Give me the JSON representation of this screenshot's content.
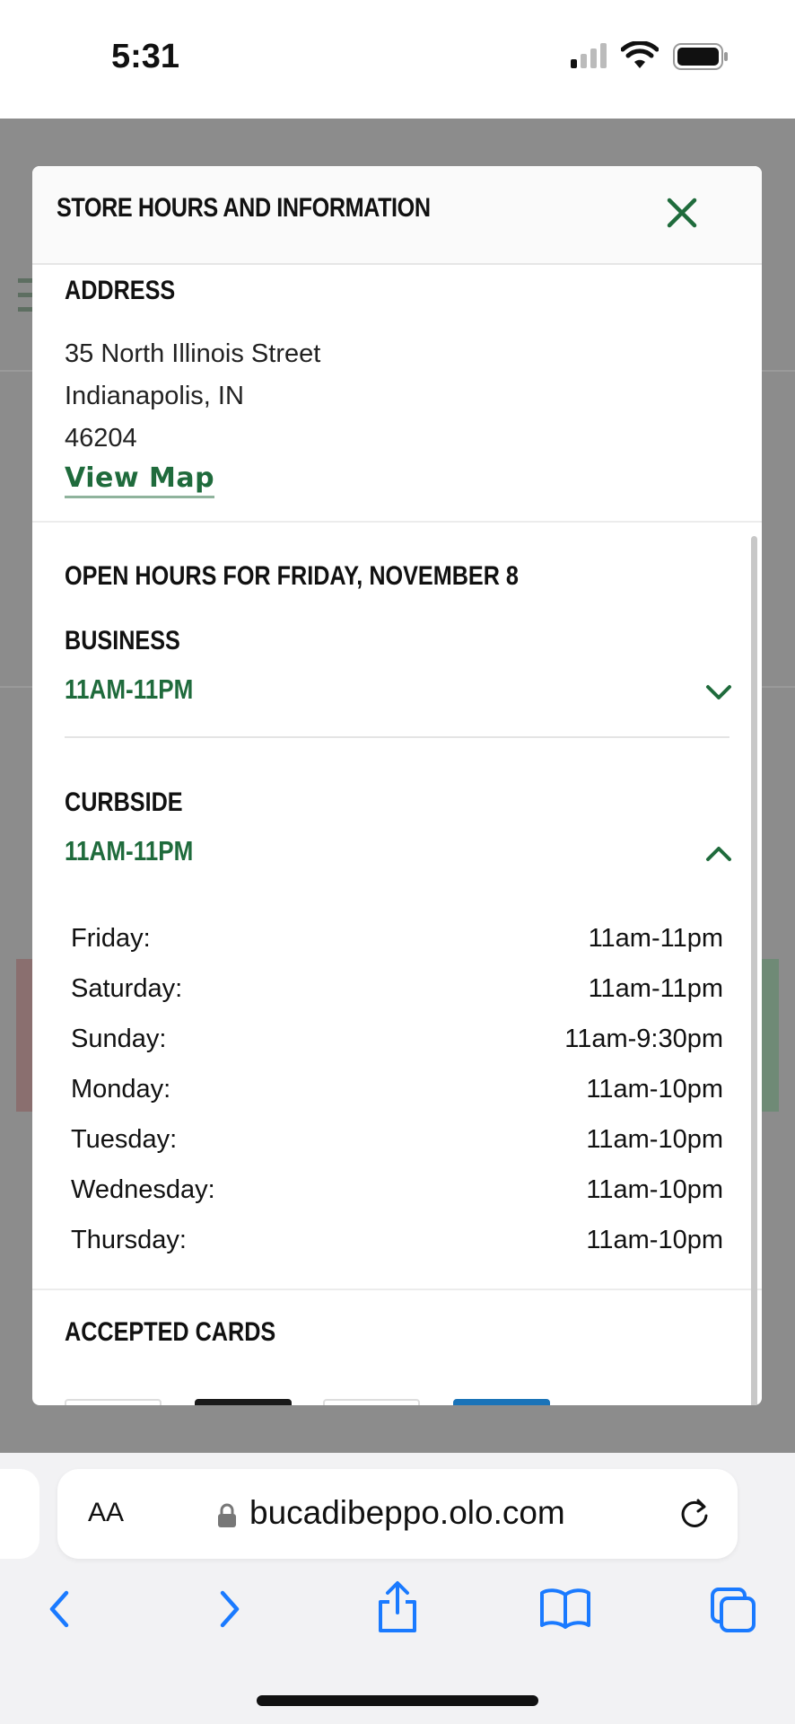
{
  "status_bar": {
    "time": "5:31"
  },
  "modal": {
    "title": "Store Hours and Information",
    "address": {
      "heading": "Address",
      "street": "35 North Illinois Street",
      "city_state": "Indianapolis, IN",
      "zip": "46204",
      "view_map": "View Map"
    },
    "open_hours_heading": "Open hours for Friday, November 8",
    "business": {
      "label": "Business",
      "hours": "11AM-11PM",
      "expanded": false
    },
    "curbside": {
      "label": "Curbside",
      "hours": "11AM-11PM",
      "expanded": true,
      "schedule": [
        {
          "day": "Friday:",
          "hours": "11am-11pm"
        },
        {
          "day": "Saturday:",
          "hours": "11am-11pm"
        },
        {
          "day": "Sunday:",
          "hours": "11am-9:30pm"
        },
        {
          "day": "Monday:",
          "hours": "11am-10pm"
        },
        {
          "day": "Tuesday:",
          "hours": "11am-10pm"
        },
        {
          "day": "Wednesday:",
          "hours": "11am-10pm"
        },
        {
          "day": "Thursday:",
          "hours": "11am-10pm"
        }
      ]
    },
    "accepted_cards_heading": "Accepted Cards"
  },
  "browser": {
    "text_size_label": "AA",
    "url": "bucadibeppo.olo.com"
  },
  "colors": {
    "brand_green": "#1f6b3c",
    "overlay": "#8c8c8c"
  }
}
